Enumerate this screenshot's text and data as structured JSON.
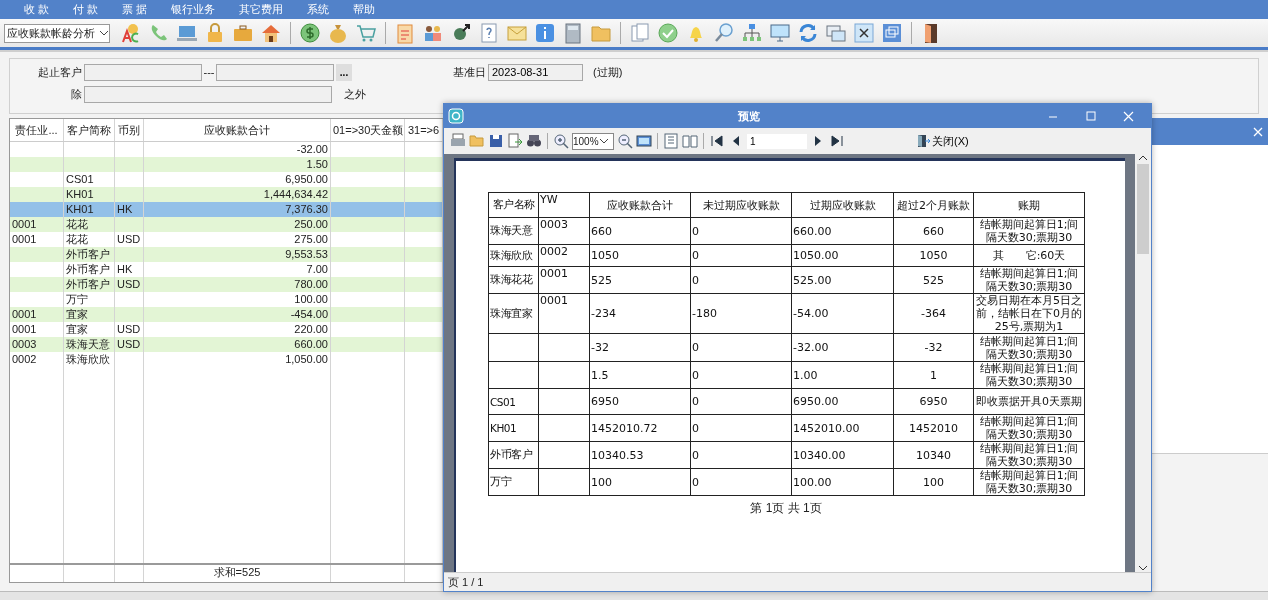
{
  "menu": [
    "收 款",
    "付 款",
    "票 据",
    "银行业务",
    "其它费用",
    "系统",
    "帮助"
  ],
  "toolbar": {
    "report_select": "应收账款帐龄分析"
  },
  "filter": {
    "customer_range_label": "起止客户",
    "range_separator": "---",
    "browse_button": "...",
    "base_date_label": "基准日",
    "base_date": "2023-08-31",
    "overdue_note": "(过期)",
    "exclude_label": "除",
    "exclude_suffix": "之外"
  },
  "grid": {
    "columns": [
      "责任业...",
      "客户简称",
      "币别",
      "应收账款合计",
      "01=>30天金额",
      "31=>6"
    ],
    "rows": [
      {
        "total": "-32.00",
        "selected": false
      },
      {
        "total": "1.50",
        "selected": false
      },
      {
        "customer": "CS01",
        "total": "6,950.00",
        "selected": false
      },
      {
        "customer": "KH01",
        "total": "1,444,634.42",
        "selected": false
      },
      {
        "customer": "KH01",
        "currency": "HK",
        "total": "7,376.30",
        "selected": true
      },
      {
        "owner": "0001",
        "customer": "花花",
        "total": "250.00",
        "selected": false
      },
      {
        "owner": "0001",
        "customer": "花花",
        "currency": "USD",
        "total": "275.00",
        "selected": false
      },
      {
        "customer": "外币客户",
        "total": "9,553.53",
        "selected": false
      },
      {
        "customer": "外币客户",
        "currency": "HK",
        "total": "7.00",
        "selected": false
      },
      {
        "customer": "外币客户",
        "currency": "USD",
        "total": "780.00",
        "selected": false
      },
      {
        "customer": "万宁",
        "total": "100.00",
        "selected": false
      },
      {
        "owner": "0001",
        "customer": "宜家",
        "total": "-454.00",
        "selected": false
      },
      {
        "owner": "0001",
        "customer": "宜家",
        "currency": "USD",
        "total": "220.00",
        "selected": false
      },
      {
        "owner": "0003",
        "customer": "珠海天意",
        "currency": "USD",
        "total": "660.00",
        "selected": false
      },
      {
        "owner": "0002",
        "customer": "珠海欣欣",
        "total": "1,050.00",
        "selected": false
      }
    ],
    "footer_total": "求和=525"
  },
  "preview": {
    "title": "预览",
    "zoom": "100%",
    "page": "1",
    "close_button": "关闭(X)",
    "report": {
      "columns": [
        "客户名称",
        "YW",
        "应收账款合计",
        "未过期应收账款",
        "过期应收账款",
        "超过2个月账款",
        "账期"
      ],
      "rows": [
        {
          "customer": "珠海天意",
          "yw": "0003",
          "total": "660",
          "not_due": "0",
          "overdue": "660.00",
          "over_2_months": "660",
          "terms": "结帐期间起算日1;间隔天数30;票期30"
        },
        {
          "customer": "珠海欣欣",
          "yw": "0002",
          "total": "1050",
          "not_due": "0",
          "overdue": "1050.00",
          "over_2_months": "1050",
          "terms": "其　　它:60天"
        },
        {
          "customer": "珠海花花",
          "yw": "0001",
          "total": "525",
          "not_due": "0",
          "overdue": "525.00",
          "over_2_months": "525",
          "terms": "结帐期间起算日1;间隔天数30;票期30"
        },
        {
          "customer": "珠海宜家",
          "yw": "0001",
          "total": "-234",
          "not_due": "-180",
          "overdue": "-54.00",
          "over_2_months": "-364",
          "terms": "交易日期在本月5日之前，结帐日在下0月的25号,票期为1"
        },
        {
          "total": "-32",
          "not_due": "0",
          "overdue": "-32.00",
          "over_2_months": "-32",
          "terms": "结帐期间起算日1;间隔天数30;票期30"
        },
        {
          "total": "1.5",
          "not_due": "0",
          "overdue": "1.00",
          "over_2_months": "1",
          "terms": "结帐期间起算日1;间隔天数30;票期30"
        },
        {
          "customer": "CS01",
          "total": "6950",
          "not_due": "0",
          "overdue": "6950.00",
          "over_2_months": "6950",
          "terms": "即收票据开具0天票期"
        },
        {
          "customer": "KH01",
          "total": "1452010.72",
          "not_due": "0",
          "overdue": "1452010.00",
          "over_2_months": "1452010",
          "terms": "结帐期间起算日1;间隔天数30;票期30"
        },
        {
          "customer": "外币客户",
          "total": "10340.53",
          "not_due": "0",
          "overdue": "10340.00",
          "over_2_months": "10340",
          "terms": "结帐期间起算日1;间隔天数30;票期30"
        },
        {
          "customer": "万宁",
          "total": "100",
          "not_due": "0",
          "overdue": "100.00",
          "over_2_months": "100",
          "terms": "结帐期间起算日1;间隔天数30;票期30"
        }
      ]
    },
    "page_footer": "第 1页 共 1页",
    "status": "页 1 / 1"
  }
}
